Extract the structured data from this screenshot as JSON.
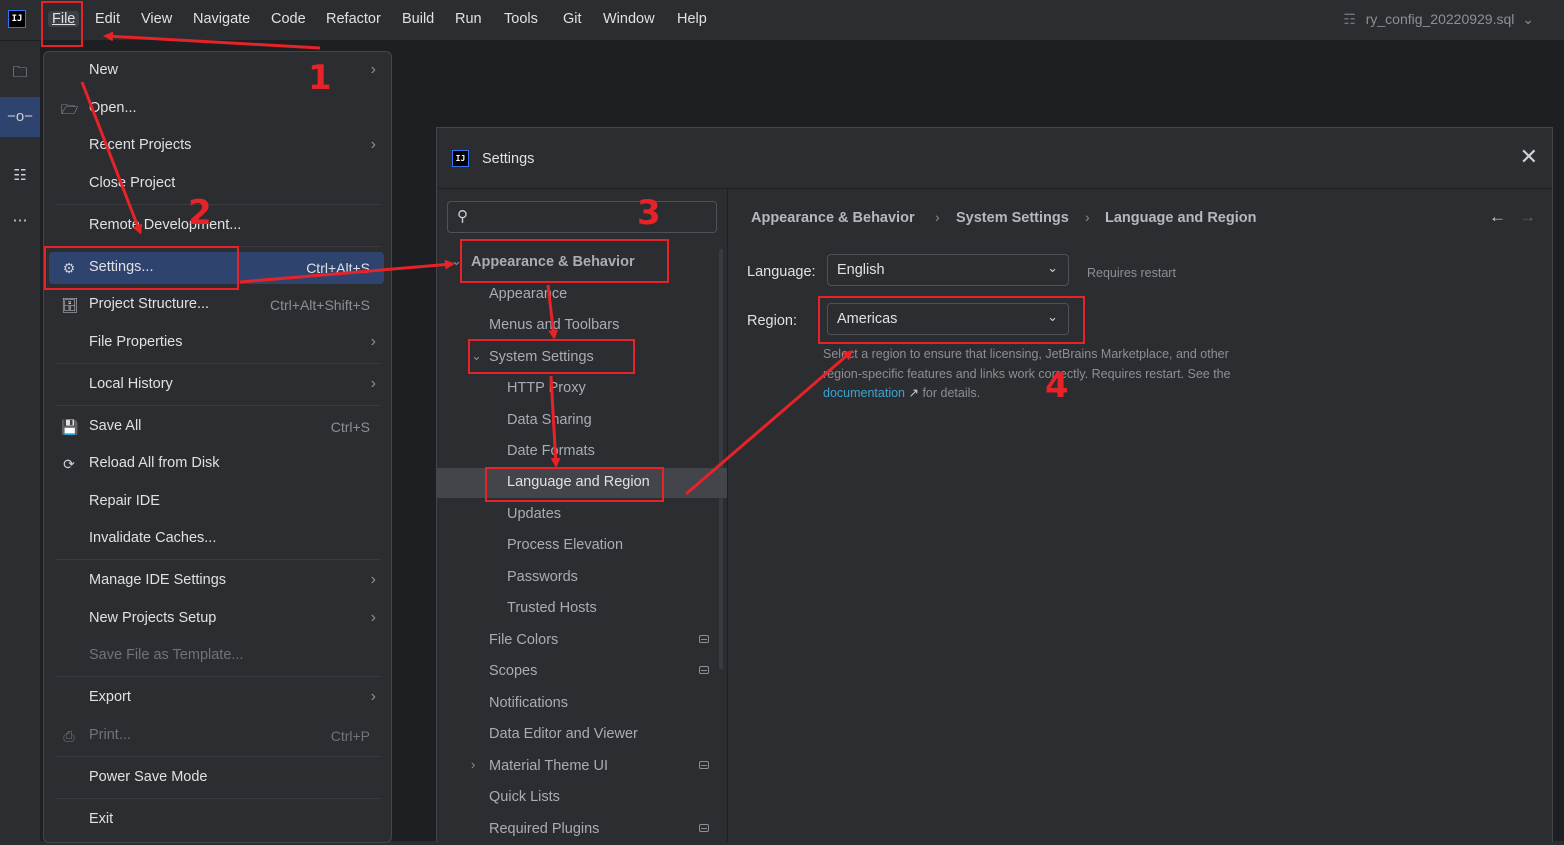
{
  "menubar": {
    "logo": "IJ",
    "items": [
      "File",
      "Edit",
      "View",
      "Navigate",
      "Code",
      "Refactor",
      "Build",
      "Run",
      "Tools",
      "Git",
      "Window",
      "Help"
    ],
    "file_title": "ry_config_20220929.sql"
  },
  "file_menu": {
    "items": [
      {
        "label": "New",
        "submenu": true
      },
      {
        "label": "Open...",
        "icon": "folder-icon"
      },
      {
        "label": "Recent Projects",
        "submenu": true
      },
      {
        "label": "Close Project"
      },
      {
        "label": "Remote Development..."
      },
      {
        "label": "Settings...",
        "icon": "gear-icon",
        "shortcut": "Ctrl+Alt+S",
        "selected": true
      },
      {
        "label": "Project Structure...",
        "icon": "project-structure-icon",
        "shortcut": "Ctrl+Alt+Shift+S"
      },
      {
        "label": "File Properties",
        "submenu": true
      },
      {
        "label": "Local History",
        "submenu": true
      },
      {
        "label": "Save All",
        "icon": "save-icon",
        "shortcut": "Ctrl+S"
      },
      {
        "label": "Reload All from Disk",
        "icon": "reload-icon"
      },
      {
        "label": "Repair IDE"
      },
      {
        "label": "Invalidate Caches..."
      },
      {
        "label": "Manage IDE Settings",
        "submenu": true
      },
      {
        "label": "New Projects Setup",
        "submenu": true
      },
      {
        "label": "Save File as Template...",
        "disabled": true
      },
      {
        "label": "Export",
        "submenu": true
      },
      {
        "label": "Print...",
        "icon": "print-icon",
        "shortcut": "Ctrl+P",
        "disabled": true
      },
      {
        "label": "Power Save Mode"
      },
      {
        "label": "Exit"
      }
    ]
  },
  "settings": {
    "title": "Settings",
    "logo": "IJ",
    "search_placeholder": "",
    "tree": [
      {
        "label": "Appearance & Behavior",
        "level": 0,
        "expanded": true,
        "bold": true
      },
      {
        "label": "Appearance",
        "level": 1
      },
      {
        "label": "Menus and Toolbars",
        "level": 1
      },
      {
        "label": "System Settings",
        "level": 1,
        "expanded": true
      },
      {
        "label": "HTTP Proxy",
        "level": 2
      },
      {
        "label": "Data Sharing",
        "level": 2
      },
      {
        "label": "Date Formats",
        "level": 2
      },
      {
        "label": "Language and Region",
        "level": 2,
        "selected": true
      },
      {
        "label": "Updates",
        "level": 2
      },
      {
        "label": "Process Elevation",
        "level": 2
      },
      {
        "label": "Passwords",
        "level": 2
      },
      {
        "label": "Trusted Hosts",
        "level": 2
      },
      {
        "label": "File Colors",
        "level": 1,
        "badge": true
      },
      {
        "label": "Scopes",
        "level": 1,
        "badge": true
      },
      {
        "label": "Notifications",
        "level": 1
      },
      {
        "label": "Data Editor and Viewer",
        "level": 1
      },
      {
        "label": "Material Theme UI",
        "level": 1,
        "collapsed": true,
        "badge": true
      },
      {
        "label": "Quick Lists",
        "level": 1
      },
      {
        "label": "Required Plugins",
        "level": 1,
        "badge": true
      }
    ],
    "breadcrumb": [
      "Appearance & Behavior",
      "System Settings",
      "Language and Region"
    ],
    "language_label": "Language:",
    "language_value": "English",
    "requires_restart": "Requires restart",
    "region_label": "Region:",
    "region_value": "Americas",
    "help_before": "Select a region to ensure that licensing, JetBrains Marketplace, and other region-specific features and links work correctly. Requires restart. See the ",
    "help_link": "documentation",
    "help_after": " for details."
  },
  "annotations": {
    "color": "#e52329",
    "steps": [
      "1",
      "2",
      "3",
      "4"
    ]
  }
}
